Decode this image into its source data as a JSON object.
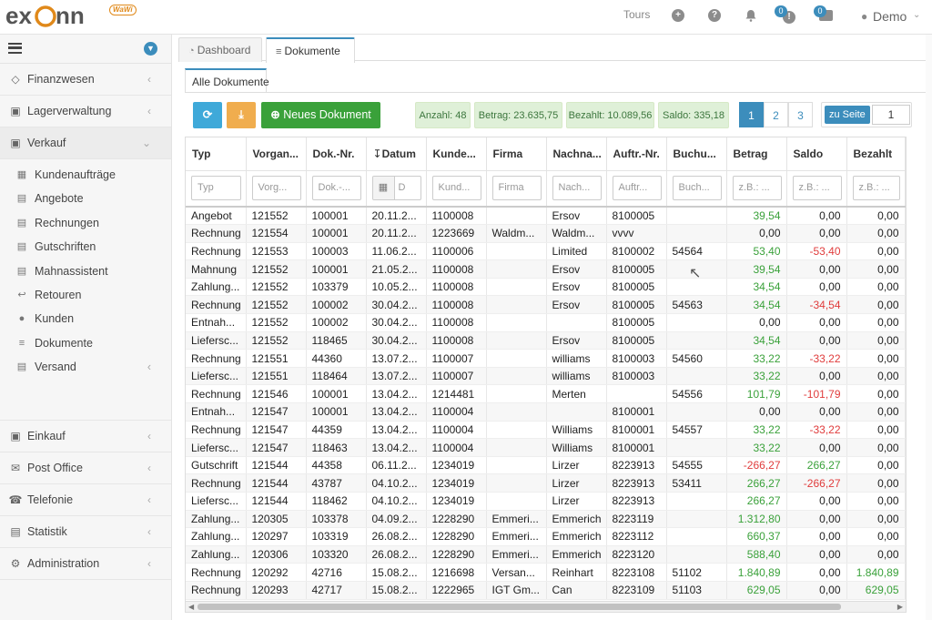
{
  "app": {
    "badge": "WaWi"
  },
  "topbar": {
    "tours": "Tours",
    "notif_count": "0",
    "msg_count": "0",
    "user": "Demo"
  },
  "sidebar": {
    "items": [
      {
        "label": "Finanzwesen",
        "icon": "bank-icon"
      },
      {
        "label": "Lagerverwaltung",
        "icon": "warehouse-icon"
      },
      {
        "label": "Verkauf",
        "icon": "cart-icon"
      },
      {
        "label": "Einkauf",
        "icon": "truck-icon"
      },
      {
        "label": "Post Office",
        "icon": "mail-icon"
      },
      {
        "label": "Telefonie",
        "icon": "headset-icon"
      },
      {
        "label": "Statistik",
        "icon": "bar-chart-icon"
      },
      {
        "label": "Administration",
        "icon": "gears-icon"
      }
    ],
    "sub": [
      {
        "label": "Kundenaufträge",
        "icon": "orders-icon"
      },
      {
        "label": "Angebote",
        "icon": "quote-icon"
      },
      {
        "label": "Rechnungen",
        "icon": "invoice-icon"
      },
      {
        "label": "Gutschriften",
        "icon": "credit-icon"
      },
      {
        "label": "Mahnassistent",
        "icon": "printer-icon"
      },
      {
        "label": "Retouren",
        "icon": "return-icon"
      },
      {
        "label": "Kunden",
        "icon": "user-icon"
      },
      {
        "label": "Dokumente",
        "icon": "stack-icon"
      },
      {
        "label": "Versand",
        "icon": "shipping-icon"
      }
    ]
  },
  "tabs": [
    "Dashboard",
    "Dokumente"
  ],
  "subtabs": [
    "Alle Dokumente"
  ],
  "toolbar": {
    "new_doc": "Neues Dokument",
    "anzahl": "Anzahl: 48",
    "betrag": "Betrag: 23.635,75",
    "bezahlt": "Bezahlt: 10.089,56",
    "saldo": "Saldo: 335,18",
    "pages": [
      "1",
      "2",
      "3"
    ],
    "goto_label": "zu Seite",
    "goto_value": "1"
  },
  "columns": [
    "Typ",
    "Vorgan...",
    "Dok.-Nr.",
    "Datum",
    "Kunde...",
    "Firma",
    "Nachna...",
    "Auftr.-Nr.",
    "Buchu...",
    "Betrag",
    "Saldo",
    "Bezahlt"
  ],
  "filters": [
    "Typ",
    "Vorg...",
    "Dok.-...",
    "D",
    "Kund...",
    "Firma",
    "Nach...",
    "Auftr...",
    "Buch...",
    "z.B.: ...",
    "z.B.: ...",
    "z.B.: ..."
  ],
  "rows": [
    [
      "Angebot",
      "121552",
      "100001",
      "20.11.2...",
      "1100008",
      "",
      "Ersov",
      "8100005",
      "",
      "39,54",
      "0,00",
      "0,00"
    ],
    [
      "Rechnung",
      "121554",
      "100001",
      "20.11.2...",
      "1223669",
      "Waldm...",
      "Waldm...",
      "vvvv",
      "",
      "0,00",
      "0,00",
      "0,00"
    ],
    [
      "Rechnung",
      "121553",
      "100003",
      "11.06.2...",
      "1100006",
      "",
      "Limited",
      "8100002",
      "54564",
      "53,40",
      "-53,40",
      "0,00"
    ],
    [
      "Mahnung",
      "121552",
      "100001",
      "21.05.2...",
      "1100008",
      "",
      "Ersov",
      "8100005",
      "",
      "39,54",
      "0,00",
      "0,00"
    ],
    [
      "Zahlung...",
      "121552",
      "103379",
      "10.05.2...",
      "1100008",
      "",
      "Ersov",
      "8100005",
      "",
      "34,54",
      "0,00",
      "0,00"
    ],
    [
      "Rechnung",
      "121552",
      "100002",
      "30.04.2...",
      "1100008",
      "",
      "Ersov",
      "8100005",
      "54563",
      "34,54",
      "-34,54",
      "0,00"
    ],
    [
      "Entnah...",
      "121552",
      "100002",
      "30.04.2...",
      "1100008",
      "",
      "",
      "8100005",
      "",
      "0,00",
      "0,00",
      "0,00"
    ],
    [
      "Liefersc...",
      "121552",
      "118465",
      "30.04.2...",
      "1100008",
      "",
      "Ersov",
      "8100005",
      "",
      "34,54",
      "0,00",
      "0,00"
    ],
    [
      "Rechnung",
      "121551",
      "44360",
      "13.07.2...",
      "1100007",
      "",
      "williams",
      "8100003",
      "54560",
      "33,22",
      "-33,22",
      "0,00"
    ],
    [
      "Liefersc...",
      "121551",
      "118464",
      "13.07.2...",
      "1100007",
      "",
      "williams",
      "8100003",
      "",
      "33,22",
      "0,00",
      "0,00"
    ],
    [
      "Rechnung",
      "121546",
      "100001",
      "13.04.2...",
      "1214481",
      "",
      "Merten",
      "",
      "54556",
      "101,79",
      "-101,79",
      "0,00"
    ],
    [
      "Entnah...",
      "121547",
      "100001",
      "13.04.2...",
      "1100004",
      "",
      "",
      "8100001",
      "",
      "0,00",
      "0,00",
      "0,00"
    ],
    [
      "Rechnung",
      "121547",
      "44359",
      "13.04.2...",
      "1100004",
      "",
      "Williams",
      "8100001",
      "54557",
      "33,22",
      "-33,22",
      "0,00"
    ],
    [
      "Liefersc...",
      "121547",
      "118463",
      "13.04.2...",
      "1100004",
      "",
      "Williams",
      "8100001",
      "",
      "33,22",
      "0,00",
      "0,00"
    ],
    [
      "Gutschrift",
      "121544",
      "44358",
      "06.11.2...",
      "1234019",
      "",
      "Lirzer",
      "8223913",
      "54555",
      "-266,27",
      "266,27",
      "0,00"
    ],
    [
      "Rechnung",
      "121544",
      "43787",
      "04.10.2...",
      "1234019",
      "",
      "Lirzer",
      "8223913",
      "53411",
      "266,27",
      "-266,27",
      "0,00"
    ],
    [
      "Liefersc...",
      "121544",
      "118462",
      "04.10.2...",
      "1234019",
      "",
      "Lirzer",
      "8223913",
      "",
      "266,27",
      "0,00",
      "0,00"
    ],
    [
      "Zahlung...",
      "120305",
      "103378",
      "04.09.2...",
      "1228290",
      "Emmeri...",
      "Emmerich",
      "8223119",
      "",
      "1.312,80",
      "0,00",
      "0,00"
    ],
    [
      "Zahlung...",
      "120297",
      "103319",
      "26.08.2...",
      "1228290",
      "Emmeri...",
      "Emmerich",
      "8223112",
      "",
      "660,37",
      "0,00",
      "0,00"
    ],
    [
      "Zahlung...",
      "120306",
      "103320",
      "26.08.2...",
      "1228290",
      "Emmeri...",
      "Emmerich",
      "8223120",
      "",
      "588,40",
      "0,00",
      "0,00"
    ],
    [
      "Rechnung",
      "120292",
      "42716",
      "15.08.2...",
      "1216698",
      "Versan...",
      "Reinhart",
      "8223108",
      "51102",
      "1.840,89",
      "0,00",
      "1.840,89"
    ],
    [
      "Rechnung",
      "120293",
      "42717",
      "15.08.2...",
      "1222965",
      "IGT Gm...",
      "Can",
      "8223109",
      "51103",
      "629,05",
      "0,00",
      "629,05"
    ]
  ]
}
